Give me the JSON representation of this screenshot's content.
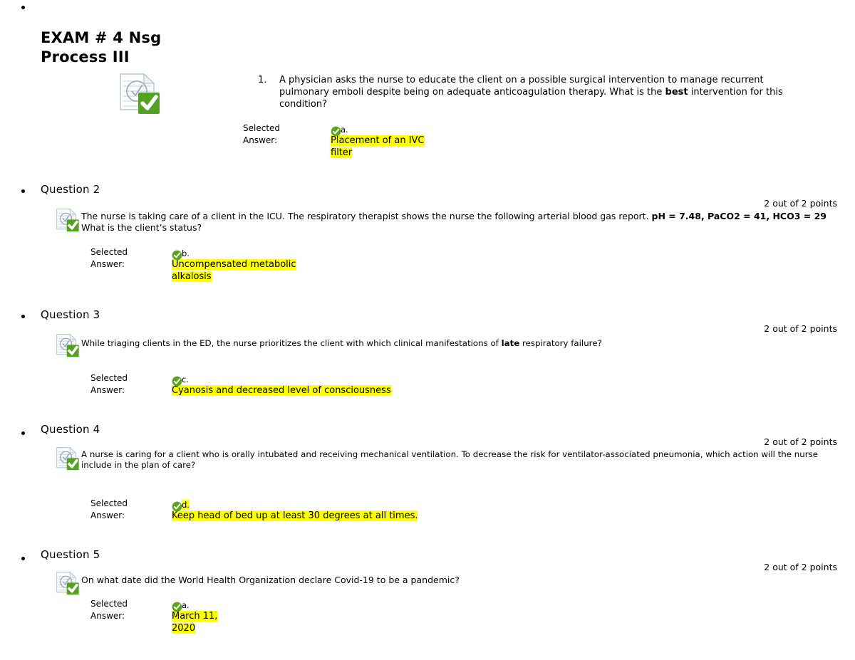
{
  "document": {
    "title_line1": "EXAM # 4 Nsg",
    "title_line2": "Process III"
  },
  "icons": {
    "document_check": "document-check-icon",
    "correct_answer": "green-check-circle-icon",
    "bullet": "bullet-marker"
  },
  "colors": {
    "highlight": "#ffff00",
    "check_green": "#5aa417",
    "badge_green": "#4e9a1e",
    "text": "#000000"
  },
  "questions": [
    {
      "heading": "",
      "number_label": "1.",
      "points": "",
      "text_parts": [
        {
          "t": "A physician asks the nurse to educate the client on a possible surgical intervention to manage recurrent pulmonary emboli despite being on adequate anticoagulation therapy. What is the ",
          "b": false
        },
        {
          "t": "best",
          "b": true
        },
        {
          "t": " intervention for this condition?",
          "b": false
        }
      ],
      "selected_label_line1": "Selected",
      "selected_label_line2": "Answer:",
      "answer_letter": "a.",
      "answer_letter_highlighted": false,
      "answer_lines": [
        "Placement of an IVC",
        "filter"
      ]
    },
    {
      "heading": "Question 2",
      "number_label": "",
      "points": "2 out of 2 points",
      "text_parts": [
        {
          "t": "The nurse is taking care of a client in the ICU. The respiratory therapist shows the nurse the following arterial blood gas report. ",
          "b": false
        },
        {
          "t": "pH = 7.48, PaCO2 = 41, HCO3 = 29",
          "b": true
        },
        {
          "t": " What is the client’s status?",
          "b": false
        }
      ],
      "selected_label_line1": "Selected",
      "selected_label_line2": "Answer:",
      "answer_letter": "b.",
      "answer_letter_highlighted": false,
      "answer_lines": [
        "Uncompensated metabolic",
        "alkalosis"
      ]
    },
    {
      "heading": "Question 3",
      "number_label": "",
      "points": "2 out of 2 points",
      "text_parts": [
        {
          "t": "While triaging clients in the ED, the nurse prioritizes the client with which clinical manifestations of ",
          "b": false
        },
        {
          "t": "late",
          "b": true
        },
        {
          "t": " respiratory failure?",
          "b": false
        }
      ],
      "selected_label_line1": "Selected",
      "selected_label_line2": "Answer:",
      "answer_letter": "c.",
      "answer_letter_highlighted": false,
      "answer_lines": [
        "Cyanosis and decreased level of consciousness"
      ]
    },
    {
      "heading": "Question 4",
      "number_label": "",
      "points": "2 out of 2 points",
      "text_parts": [
        {
          "t": "A nurse is caring for a client who is orally intubated and receiving mechanical ventilation. To decrease the risk for ventilator-associated pneumonia, which action will the nurse include in the plan of care?",
          "b": false
        }
      ],
      "selected_label_line1": "Selected",
      "selected_label_line2": "Answer:",
      "answer_letter": "d.",
      "answer_letter_highlighted": true,
      "answer_lines": [
        "Keep head of bed up at least 30 degrees at all times."
      ]
    },
    {
      "heading": "Question 5",
      "number_label": "",
      "points": "2 out of 2 points",
      "text_parts": [
        {
          "t": "On what date did the World Health Organization declare Covid-19 to be a pandemic?",
          "b": false
        }
      ],
      "selected_label_line1": "Selected",
      "selected_label_line2": "Answer:",
      "answer_letter": "a.",
      "answer_letter_highlighted": false,
      "answer_lines": [
        "March 11,",
        "2020"
      ]
    }
  ]
}
